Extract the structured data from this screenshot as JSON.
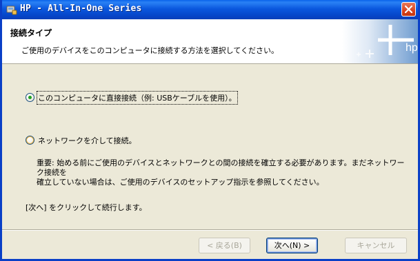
{
  "window": {
    "title": "HP - All-In-One Series",
    "title_icon": "hp-installer-icon",
    "close_icon": "close-icon"
  },
  "header": {
    "title": "接続タイプ",
    "subtitle": "ご使用のデバイスをこのコンピュータに接続する方法を選択してください。",
    "logo_text": "hp"
  },
  "options": [
    {
      "label": "このコンピュータに直接接続（例: USBケーブルを使用）。",
      "selected": true
    },
    {
      "label": "ネットワークを介して接続。",
      "selected": false
    }
  ],
  "network_note": {
    "line1": "重要: 始める前にご使用のデバイスとネットワークとの間の接続を確立する必要があります。まだネットワーク接続を",
    "line2": "確立していない場合は、ご使用のデバイスのセットアップ指示を参照してください。"
  },
  "instruction": "[次へ] をクリックして続行します。",
  "buttons": {
    "back": "< 戻る(B)",
    "next": "次へ(N) >",
    "cancel": "キャンセル"
  },
  "colors": {
    "titlebar": "#0b58de",
    "dialog_bg": "#ece9d8",
    "close_button": "#d9441f"
  }
}
